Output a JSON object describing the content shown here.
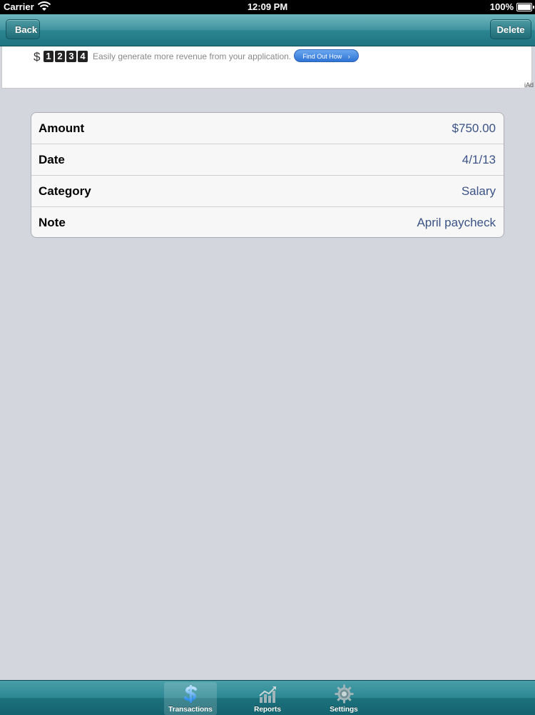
{
  "status_bar": {
    "carrier": "Carrier",
    "time": "12:09 PM",
    "battery": "100%"
  },
  "nav": {
    "back_label": "Back",
    "delete_label": "Delete"
  },
  "ad": {
    "currency": "$",
    "digits": [
      "1",
      "2",
      "3",
      "4"
    ],
    "text": "Easily generate more revenue from your application.",
    "button_label": "Find Out How",
    "label": "iAd"
  },
  "details": [
    {
      "label": "Amount",
      "value": "$750.00"
    },
    {
      "label": "Date",
      "value": "4/1/13"
    },
    {
      "label": "Category",
      "value": "Salary"
    },
    {
      "label": "Note",
      "value": "April paycheck"
    }
  ],
  "tabs": [
    {
      "label": "Transactions",
      "icon": "dollar-icon",
      "selected": true
    },
    {
      "label": "Reports",
      "icon": "chart-icon",
      "selected": false
    },
    {
      "label": "Settings",
      "icon": "gear-icon",
      "selected": false
    }
  ],
  "colors": {
    "nav_teal": "#2b8591",
    "value_blue": "#3b5386",
    "background": "#d3d7dd"
  }
}
